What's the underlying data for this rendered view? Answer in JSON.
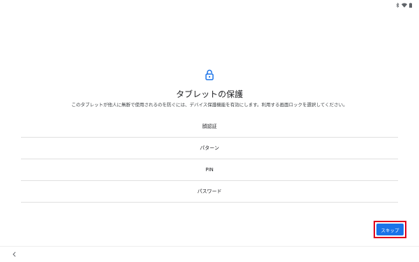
{
  "status_bar": {
    "icons": [
      "bluetooth-icon",
      "wifi-icon",
      "battery-icon"
    ]
  },
  "header": {
    "icon": "lock-open-icon",
    "title": "タブレットの保護",
    "description": "このタブレットが他人に無断で使用されるのを防ぐには、デバイス保護機能を有効にします。利用する画面ロックを選択してください。"
  },
  "options": [
    {
      "label": "顔認証"
    },
    {
      "label": "パターン"
    },
    {
      "label": "PIN"
    },
    {
      "label": "パスワード"
    }
  ],
  "actions": {
    "skip_label": "スキップ"
  },
  "navigation": {
    "back_icon": "chevron-left-icon"
  },
  "colors": {
    "accent": "#1a73e8",
    "highlight": "#e0001b",
    "divider": "#e0e0e0"
  }
}
